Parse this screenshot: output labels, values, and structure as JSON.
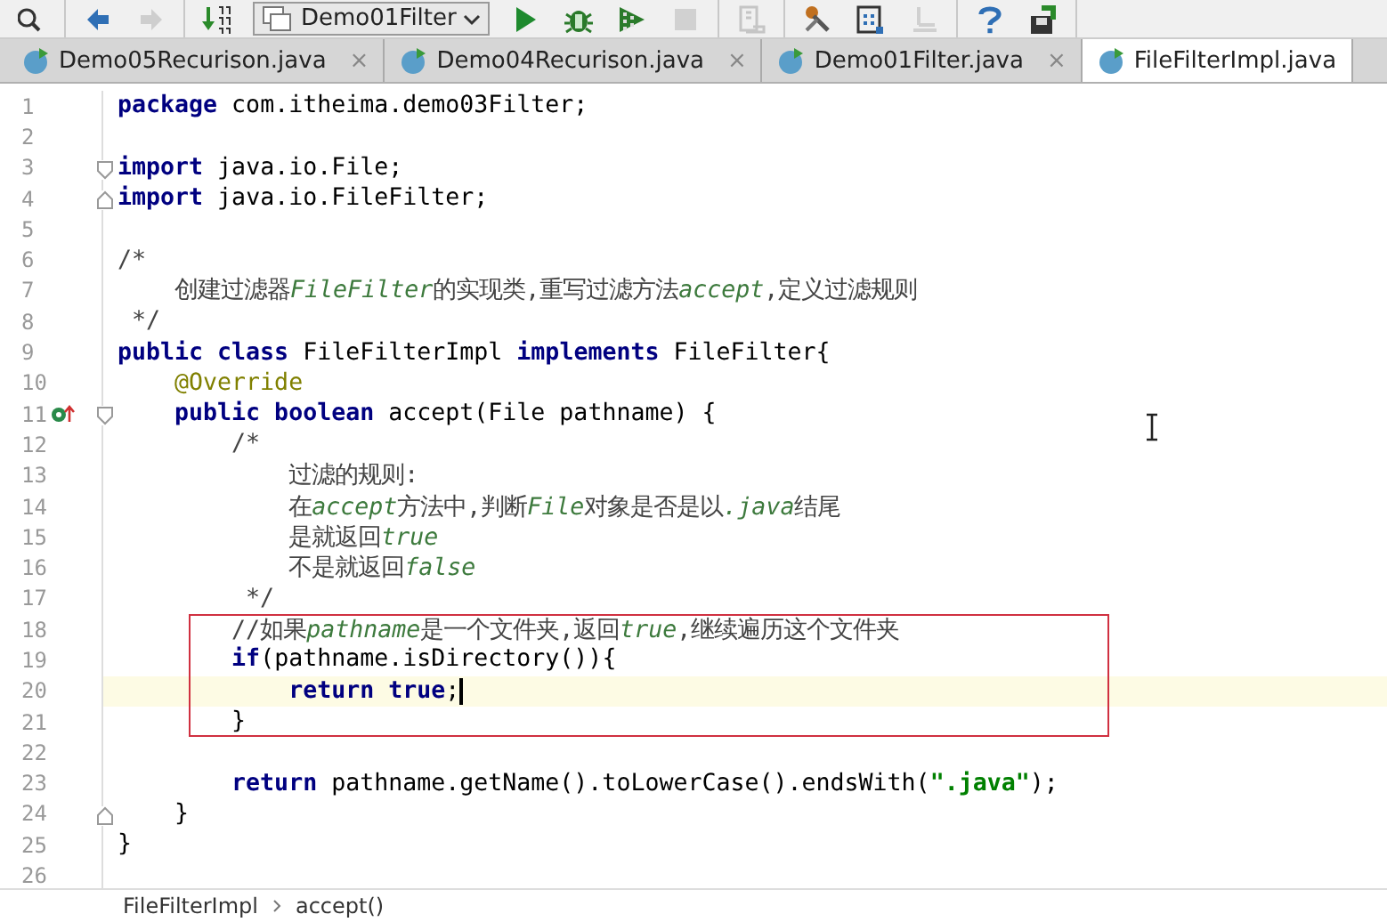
{
  "toolbar": {
    "groups": [
      [
        {
          "kind": "search",
          "disabled": false
        }
      ],
      [
        {
          "kind": "back",
          "disabled": false
        },
        {
          "kind": "forward",
          "disabled": true
        }
      ],
      [
        {
          "kind": "sort",
          "disabled": false
        },
        {
          "kind": "run-config",
          "label": "Demo01Filter",
          "disabled": false
        },
        {
          "kind": "run",
          "disabled": false
        },
        {
          "kind": "debug",
          "disabled": false
        },
        {
          "kind": "coverage",
          "disabled": false
        },
        {
          "kind": "stop",
          "disabled": true
        }
      ],
      [
        {
          "kind": "build",
          "disabled": true
        }
      ],
      [
        {
          "kind": "tools",
          "disabled": false
        },
        {
          "kind": "structure",
          "disabled": false
        },
        {
          "kind": "vcs",
          "disabled": true
        }
      ],
      [
        {
          "kind": "help",
          "disabled": false
        },
        {
          "kind": "sdk",
          "disabled": false
        }
      ]
    ]
  },
  "tabs": [
    {
      "label": "Demo05Recurison.java",
      "close": "×",
      "selected": false
    },
    {
      "label": "Demo04Recurison.java",
      "close": "×",
      "selected": false
    },
    {
      "label": "Demo01Filter.java",
      "close": "×",
      "selected": false
    },
    {
      "label": "FileFilterImpl.java",
      "selected": true
    }
  ],
  "editor": {
    "lines": [
      {
        "number": "1",
        "tokens": [
          {
            "kind": "keyword",
            "text": "package"
          },
          {
            "kind": "plain",
            "text": " com.itheima.demo03Filter;"
          }
        ]
      },
      {
        "number": "2"
      },
      {
        "number": "3",
        "gutter": [
          {
            "kind": "fold-start"
          }
        ],
        "tokens": [
          {
            "kind": "keyword",
            "text": "import"
          },
          {
            "kind": "plain",
            "text": " java.io.File;"
          }
        ]
      },
      {
        "number": "4",
        "gutter": [
          {
            "kind": "fold-end"
          }
        ],
        "tokens": [
          {
            "kind": "keyword",
            "text": "import"
          },
          {
            "kind": "plain",
            "text": " java.io.FileFilter;"
          }
        ]
      },
      {
        "number": "5"
      },
      {
        "number": "6",
        "tokens": [
          {
            "kind": "comment",
            "text": "/*"
          }
        ]
      },
      {
        "number": "7",
        "tokens": [
          {
            "kind": "comment",
            "text": "    创建过滤器"
          },
          {
            "kind": "comment-em",
            "text": "FileFilter"
          },
          {
            "kind": "comment",
            "text": "的实现类,重写过滤方法"
          },
          {
            "kind": "comment-em",
            "text": "accept"
          },
          {
            "kind": "comment",
            "text": ",定义过滤规则"
          }
        ]
      },
      {
        "number": "8",
        "tokens": [
          {
            "kind": "comment",
            "text": " */"
          }
        ]
      },
      {
        "number": "9",
        "tokens": [
          {
            "kind": "keyword",
            "text": "public class"
          },
          {
            "kind": "plain",
            "text": " FileFilterImpl "
          },
          {
            "kind": "keyword",
            "text": "implements"
          },
          {
            "kind": "plain",
            "text": " FileFilter{"
          }
        ]
      },
      {
        "number": "10",
        "tokens": [
          {
            "kind": "annotation",
            "text": "    @Override"
          }
        ]
      },
      {
        "number": "11",
        "gutter": [
          {
            "kind": "override"
          },
          {
            "kind": "fold-start"
          }
        ],
        "tokens": [
          {
            "kind": "keyword",
            "text": "    public boolean"
          },
          {
            "kind": "plain",
            "text": " accept(File pathname) {"
          }
        ]
      },
      {
        "number": "12",
        "tokens": [
          {
            "kind": "comment",
            "text": "        /*"
          }
        ]
      },
      {
        "number": "13",
        "tokens": [
          {
            "kind": "comment",
            "text": "            过滤的规则:"
          }
        ]
      },
      {
        "number": "14",
        "tokens": [
          {
            "kind": "comment",
            "text": "            在"
          },
          {
            "kind": "comment-em",
            "text": "accept"
          },
          {
            "kind": "comment",
            "text": "方法中,判断"
          },
          {
            "kind": "comment-em",
            "text": "File"
          },
          {
            "kind": "comment",
            "text": "对象是否是以"
          },
          {
            "kind": "comment-em",
            "text": ".java"
          },
          {
            "kind": "comment",
            "text": "结尾"
          }
        ]
      },
      {
        "number": "15",
        "tokens": [
          {
            "kind": "comment",
            "text": "            是就返回"
          },
          {
            "kind": "comment-em",
            "text": "true"
          }
        ]
      },
      {
        "number": "16",
        "tokens": [
          {
            "kind": "comment",
            "text": "            不是就返回"
          },
          {
            "kind": "comment-em",
            "text": "false"
          }
        ]
      },
      {
        "number": "17",
        "tokens": [
          {
            "kind": "comment",
            "text": "         */"
          }
        ]
      },
      {
        "number": "18",
        "highlighted": true,
        "tokens": [
          {
            "kind": "comment",
            "text": "        //如果"
          },
          {
            "kind": "comment-em",
            "text": "pathname"
          },
          {
            "kind": "comment",
            "text": "是一个文件夹,返回"
          },
          {
            "kind": "comment-em",
            "text": "true"
          },
          {
            "kind": "comment",
            "text": ",继续遍历这个文件夹"
          }
        ]
      },
      {
        "number": "19",
        "highlighted": true,
        "tokens": [
          {
            "kind": "keyword",
            "text": "        if"
          },
          {
            "kind": "plain",
            "text": "(pathname.isDirectory()){"
          }
        ]
      },
      {
        "number": "20",
        "highlighted": true,
        "caret": true,
        "tokens": [
          {
            "kind": "keyword",
            "text": "            return true"
          },
          {
            "kind": "plain",
            "text": ";"
          }
        ]
      },
      {
        "number": "21",
        "highlighted": true,
        "tokens": [
          {
            "kind": "plain",
            "text": "        }"
          }
        ]
      },
      {
        "number": "22"
      },
      {
        "number": "23",
        "tokens": [
          {
            "kind": "keyword",
            "text": "        return"
          },
          {
            "kind": "plain",
            "text": " pathname.getName().toLowerCase().endsWith("
          },
          {
            "kind": "string",
            "text": "\".java\""
          },
          {
            "kind": "plain",
            "text": ");"
          }
        ]
      },
      {
        "number": "24",
        "gutter": [
          {
            "kind": "fold-end"
          }
        ],
        "tokens": [
          {
            "kind": "plain",
            "text": "    }"
          }
        ]
      },
      {
        "number": "25",
        "tokens": [
          {
            "kind": "plain",
            "text": "}"
          }
        ]
      },
      {
        "number": "26"
      }
    ]
  },
  "breadcrumb": [
    "FileFilterImpl",
    "accept()"
  ]
}
